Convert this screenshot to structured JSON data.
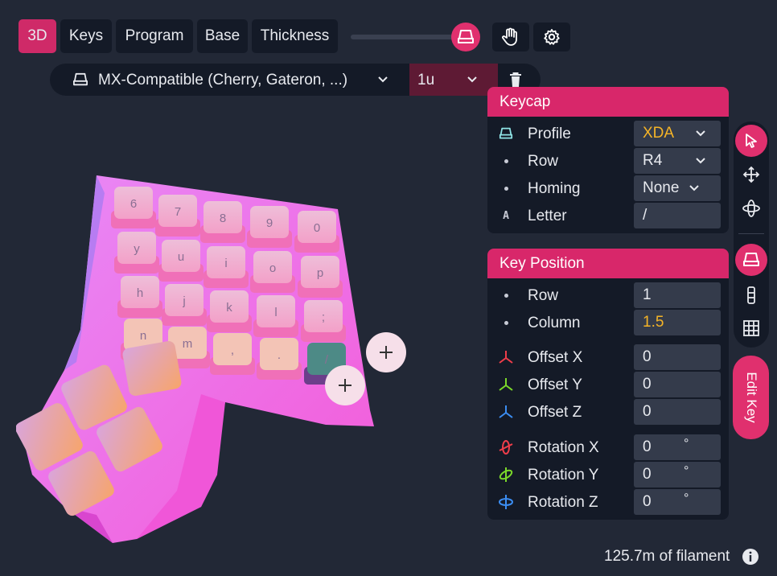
{
  "tabs": [
    {
      "label": "3D",
      "active": true
    },
    {
      "label": "Keys",
      "active": false
    },
    {
      "label": "Program",
      "active": false
    },
    {
      "label": "Base",
      "active": false
    },
    {
      "label": "Thickness",
      "active": false
    }
  ],
  "toolbar": {
    "slider_icon": "keycap-icon",
    "hand_icon": "hand-icon",
    "settings_icon": "gear-icon"
  },
  "switch": {
    "selected": "MX-Compatible (Cherry, Gateron, ...)",
    "size": "1u",
    "delete_icon": "trash-icon"
  },
  "keycap_panel": {
    "title": "Keycap",
    "rows": [
      {
        "label": "Profile",
        "value": "XDA",
        "icon": "keycap-icon"
      },
      {
        "label": "Row",
        "value": "R4",
        "icon": "dot"
      },
      {
        "label": "Homing",
        "value": "None",
        "icon": "dot"
      },
      {
        "label": "Letter",
        "value": "/",
        "icon": "letter-a-icon"
      }
    ]
  },
  "position_panel": {
    "title": "Key Position",
    "rows": [
      {
        "label": "Row",
        "value": "1"
      },
      {
        "label": "Column",
        "value": "1.5"
      },
      {
        "label": "Offset X",
        "value": "0"
      },
      {
        "label": "Offset Y",
        "value": "0"
      },
      {
        "label": "Offset Z",
        "value": "0"
      },
      {
        "label": "Rotation X",
        "value": "0",
        "unit": "°"
      },
      {
        "label": "Rotation Y",
        "value": "0",
        "unit": "°"
      },
      {
        "label": "Rotation Z",
        "value": "0",
        "unit": "°"
      }
    ]
  },
  "key_legends": [
    "6",
    "7",
    "8",
    "9",
    "0",
    "y",
    "u",
    "i",
    "o",
    "p",
    "h",
    "j",
    "k",
    "l",
    ";",
    "n",
    "m",
    ",",
    ".",
    "/"
  ],
  "tools": [
    "cursor-icon",
    "move-icon",
    "rotate-icon",
    "keycap-icon",
    "column-icon",
    "grid-icon"
  ],
  "edit_key_label": "Edit Key",
  "footer": {
    "text": "125.7m of filament",
    "icon": "info-icon"
  },
  "colors": {
    "accent": "#e0306e",
    "panel": "#141a27",
    "bg": "#222836",
    "highlight": "#f5b427"
  }
}
